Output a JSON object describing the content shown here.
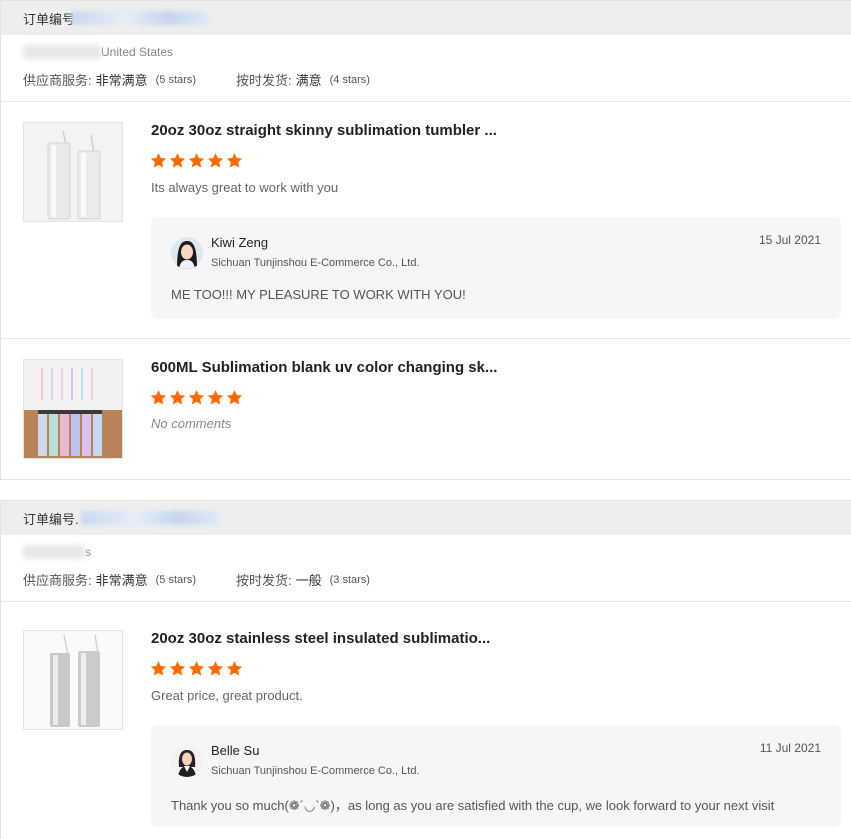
{
  "orders": [
    {
      "order_label": "订单编号",
      "buyer_country": "United States",
      "supplier_service_label": "供应商服务:",
      "supplier_service_value": "非常满意",
      "supplier_service_stars": "(5 stars)",
      "shipping_label": "按时发货:",
      "shipping_value": "满意",
      "shipping_stars": "(4 stars)",
      "items": [
        {
          "title": "20oz 30oz straight skinny sublimation tumbler ...",
          "rating": 5,
          "comment": "Its always great to work with you",
          "reply": {
            "name": "Kiwi Zeng",
            "company": "Sichuan Tunjinshou E-Commerce Co., Ltd.",
            "date": "15 Jul 2021",
            "text": "ME TOO!!! MY PLEASURE TO WORK WITH YOU!"
          }
        },
        {
          "title": "600ML Sublimation blank uv color changing sk...",
          "rating": 5,
          "comment": "No comments"
        }
      ]
    },
    {
      "order_label": "订单编号.",
      "buyer_country": "s",
      "supplier_service_label": "供应商服务:",
      "supplier_service_value": "非常满意",
      "supplier_service_stars": "(5 stars)",
      "shipping_label": "按时发货:",
      "shipping_value": "一般",
      "shipping_stars": "(3 stars)",
      "items": [
        {
          "title": "20oz 30oz stainless steel insulated sublimatio...",
          "rating": 5,
          "comment": "Great price, great product.",
          "reply": {
            "name": "Belle Su",
            "company": "Sichuan Tunjinshou E-Commerce Co., Ltd.",
            "date": "11 Jul 2021",
            "text": "Thank you so much(❁´◡`❁)，as long as you are satisfied with the cup, we look forward to your next visit"
          }
        }
      ]
    }
  ],
  "colors": {
    "star": "#ff6a00",
    "header_bg": "#eeeeee",
    "reply_bg": "#f6f6f6"
  },
  "icons": {
    "star": "star-icon"
  }
}
